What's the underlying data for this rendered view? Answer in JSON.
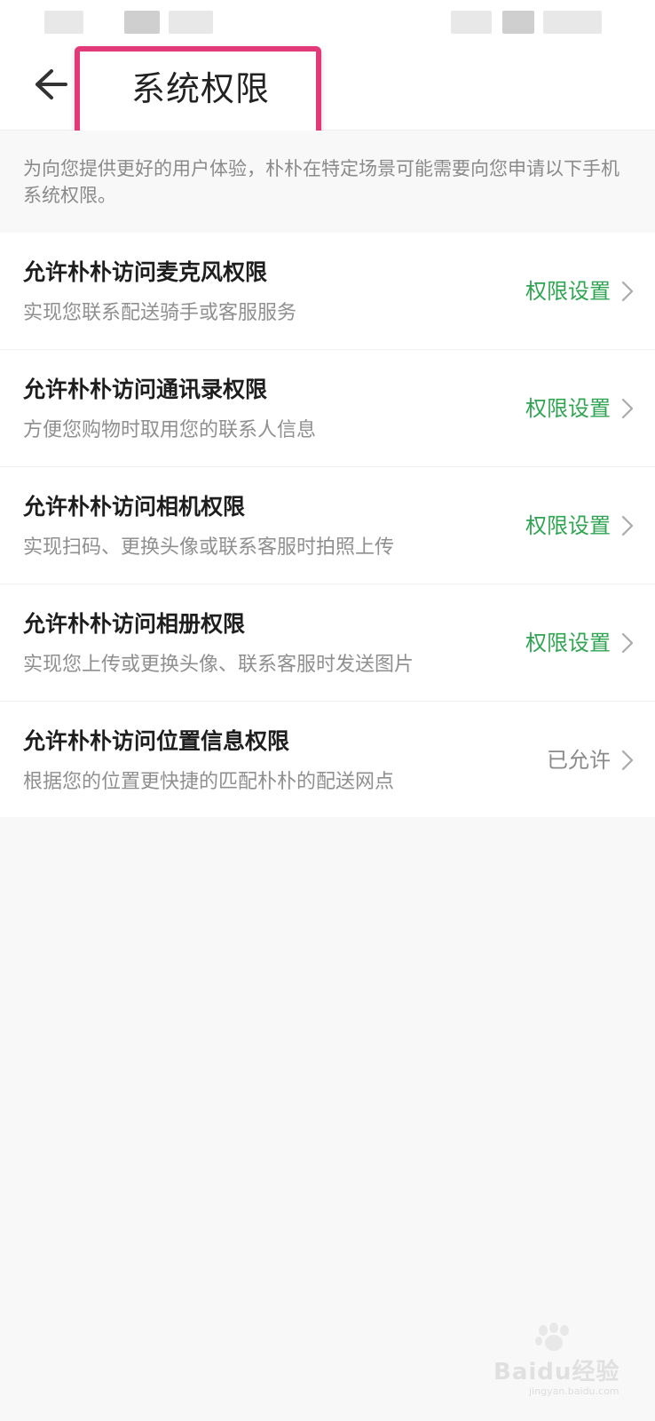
{
  "header": {
    "title": "系统权限"
  },
  "intro": {
    "text": "为向您提供更好的用户体验，朴朴在特定场景可能需要向您申请以下手机系统权限。"
  },
  "permissions": [
    {
      "title": "允许朴朴访问麦克风权限",
      "desc": "实现您联系配送骑手或客服服务",
      "action": "权限设置",
      "state": "settings"
    },
    {
      "title": "允许朴朴访问通讯录权限",
      "desc": "方便您购物时取用您的联系人信息",
      "action": "权限设置",
      "state": "settings"
    },
    {
      "title": "允许朴朴访问相机权限",
      "desc": "实现扫码、更换头像或联系客服时拍照上传",
      "action": "权限设置",
      "state": "settings"
    },
    {
      "title": "允许朴朴访问相册权限",
      "desc": "实现您上传或更换头像、联系客服时发送图片",
      "action": "权限设置",
      "state": "settings"
    },
    {
      "title": "允许朴朴访问位置信息权限",
      "desc": "根据您的位置更快捷的匹配朴朴的配送网点",
      "action": "已允许",
      "state": "allowed"
    }
  ],
  "watermark": {
    "brand": "Baidu经验",
    "url": "jingyan.baidu.com"
  },
  "colors": {
    "accent_green": "#2fa552",
    "highlight_box": "#e23a79"
  },
  "icons": {
    "back": "back-arrow-icon",
    "chevron": "chevron-right-icon"
  }
}
